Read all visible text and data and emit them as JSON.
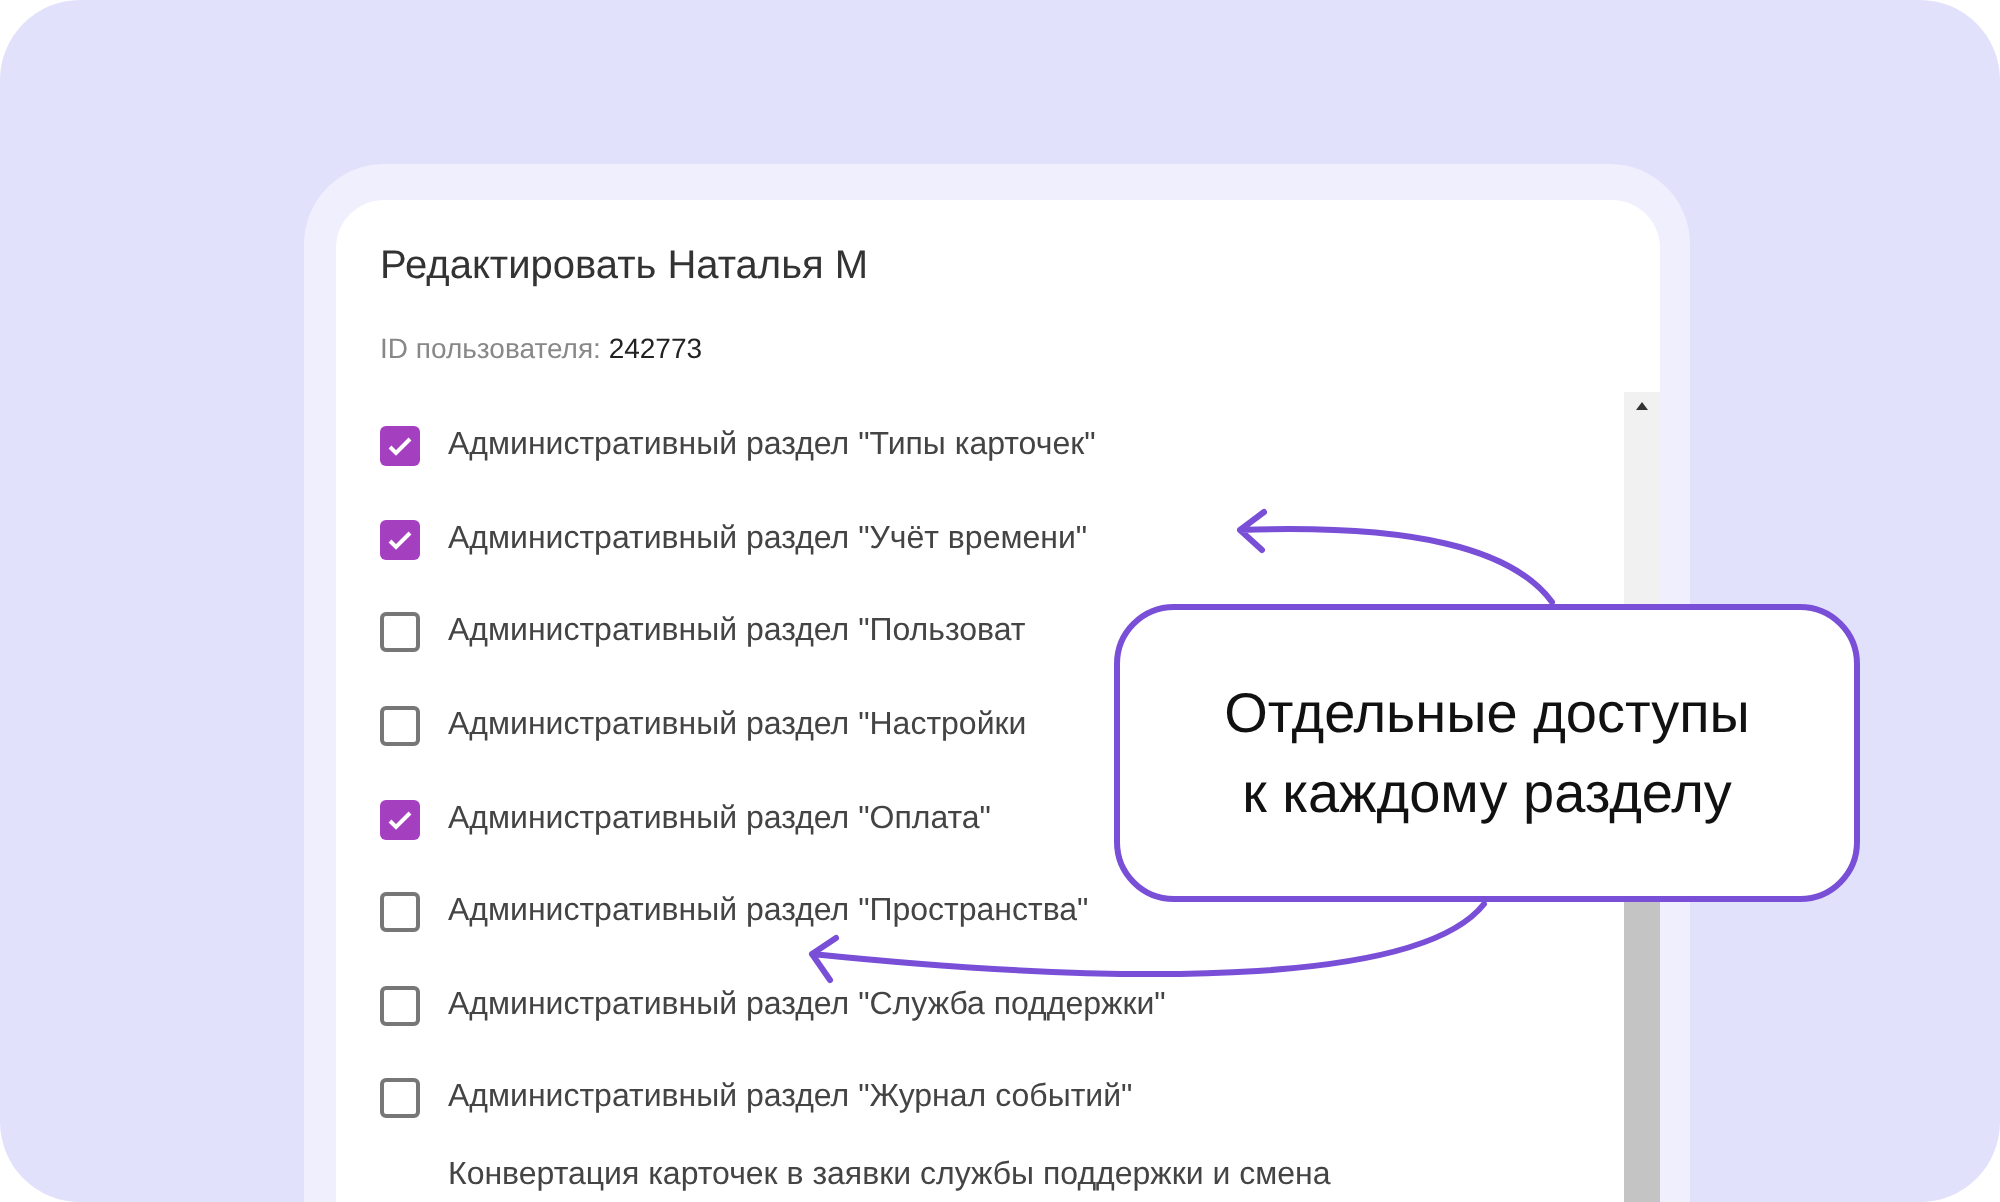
{
  "dialog": {
    "title": "Редактировать Наталья М",
    "user_id_label": "ID пользователя:",
    "user_id_value": "242773"
  },
  "permissions": [
    {
      "label": "Административный раздел \"Типы карточек\"",
      "checked": true
    },
    {
      "label": "Административный раздел \"Учёт времени\"",
      "checked": true
    },
    {
      "label": "Административный раздел \"Пользоват",
      "checked": false
    },
    {
      "label": "Административный раздел \"Настройки",
      "checked": false
    },
    {
      "label": "Административный раздел \"Оплата\"",
      "checked": true
    },
    {
      "label": "Административный раздел \"Пространства\"",
      "checked": false
    },
    {
      "label": "Административный раздел \"Служба поддержки\"",
      "checked": false
    },
    {
      "label": "Административный раздел \"Журнал событий\"",
      "checked": false
    }
  ],
  "cut_line": "Конвертация карточек в заявки службы поддержки и смена",
  "callout": {
    "lines": [
      "Отдельные доступы",
      "к каждому разделу"
    ]
  }
}
